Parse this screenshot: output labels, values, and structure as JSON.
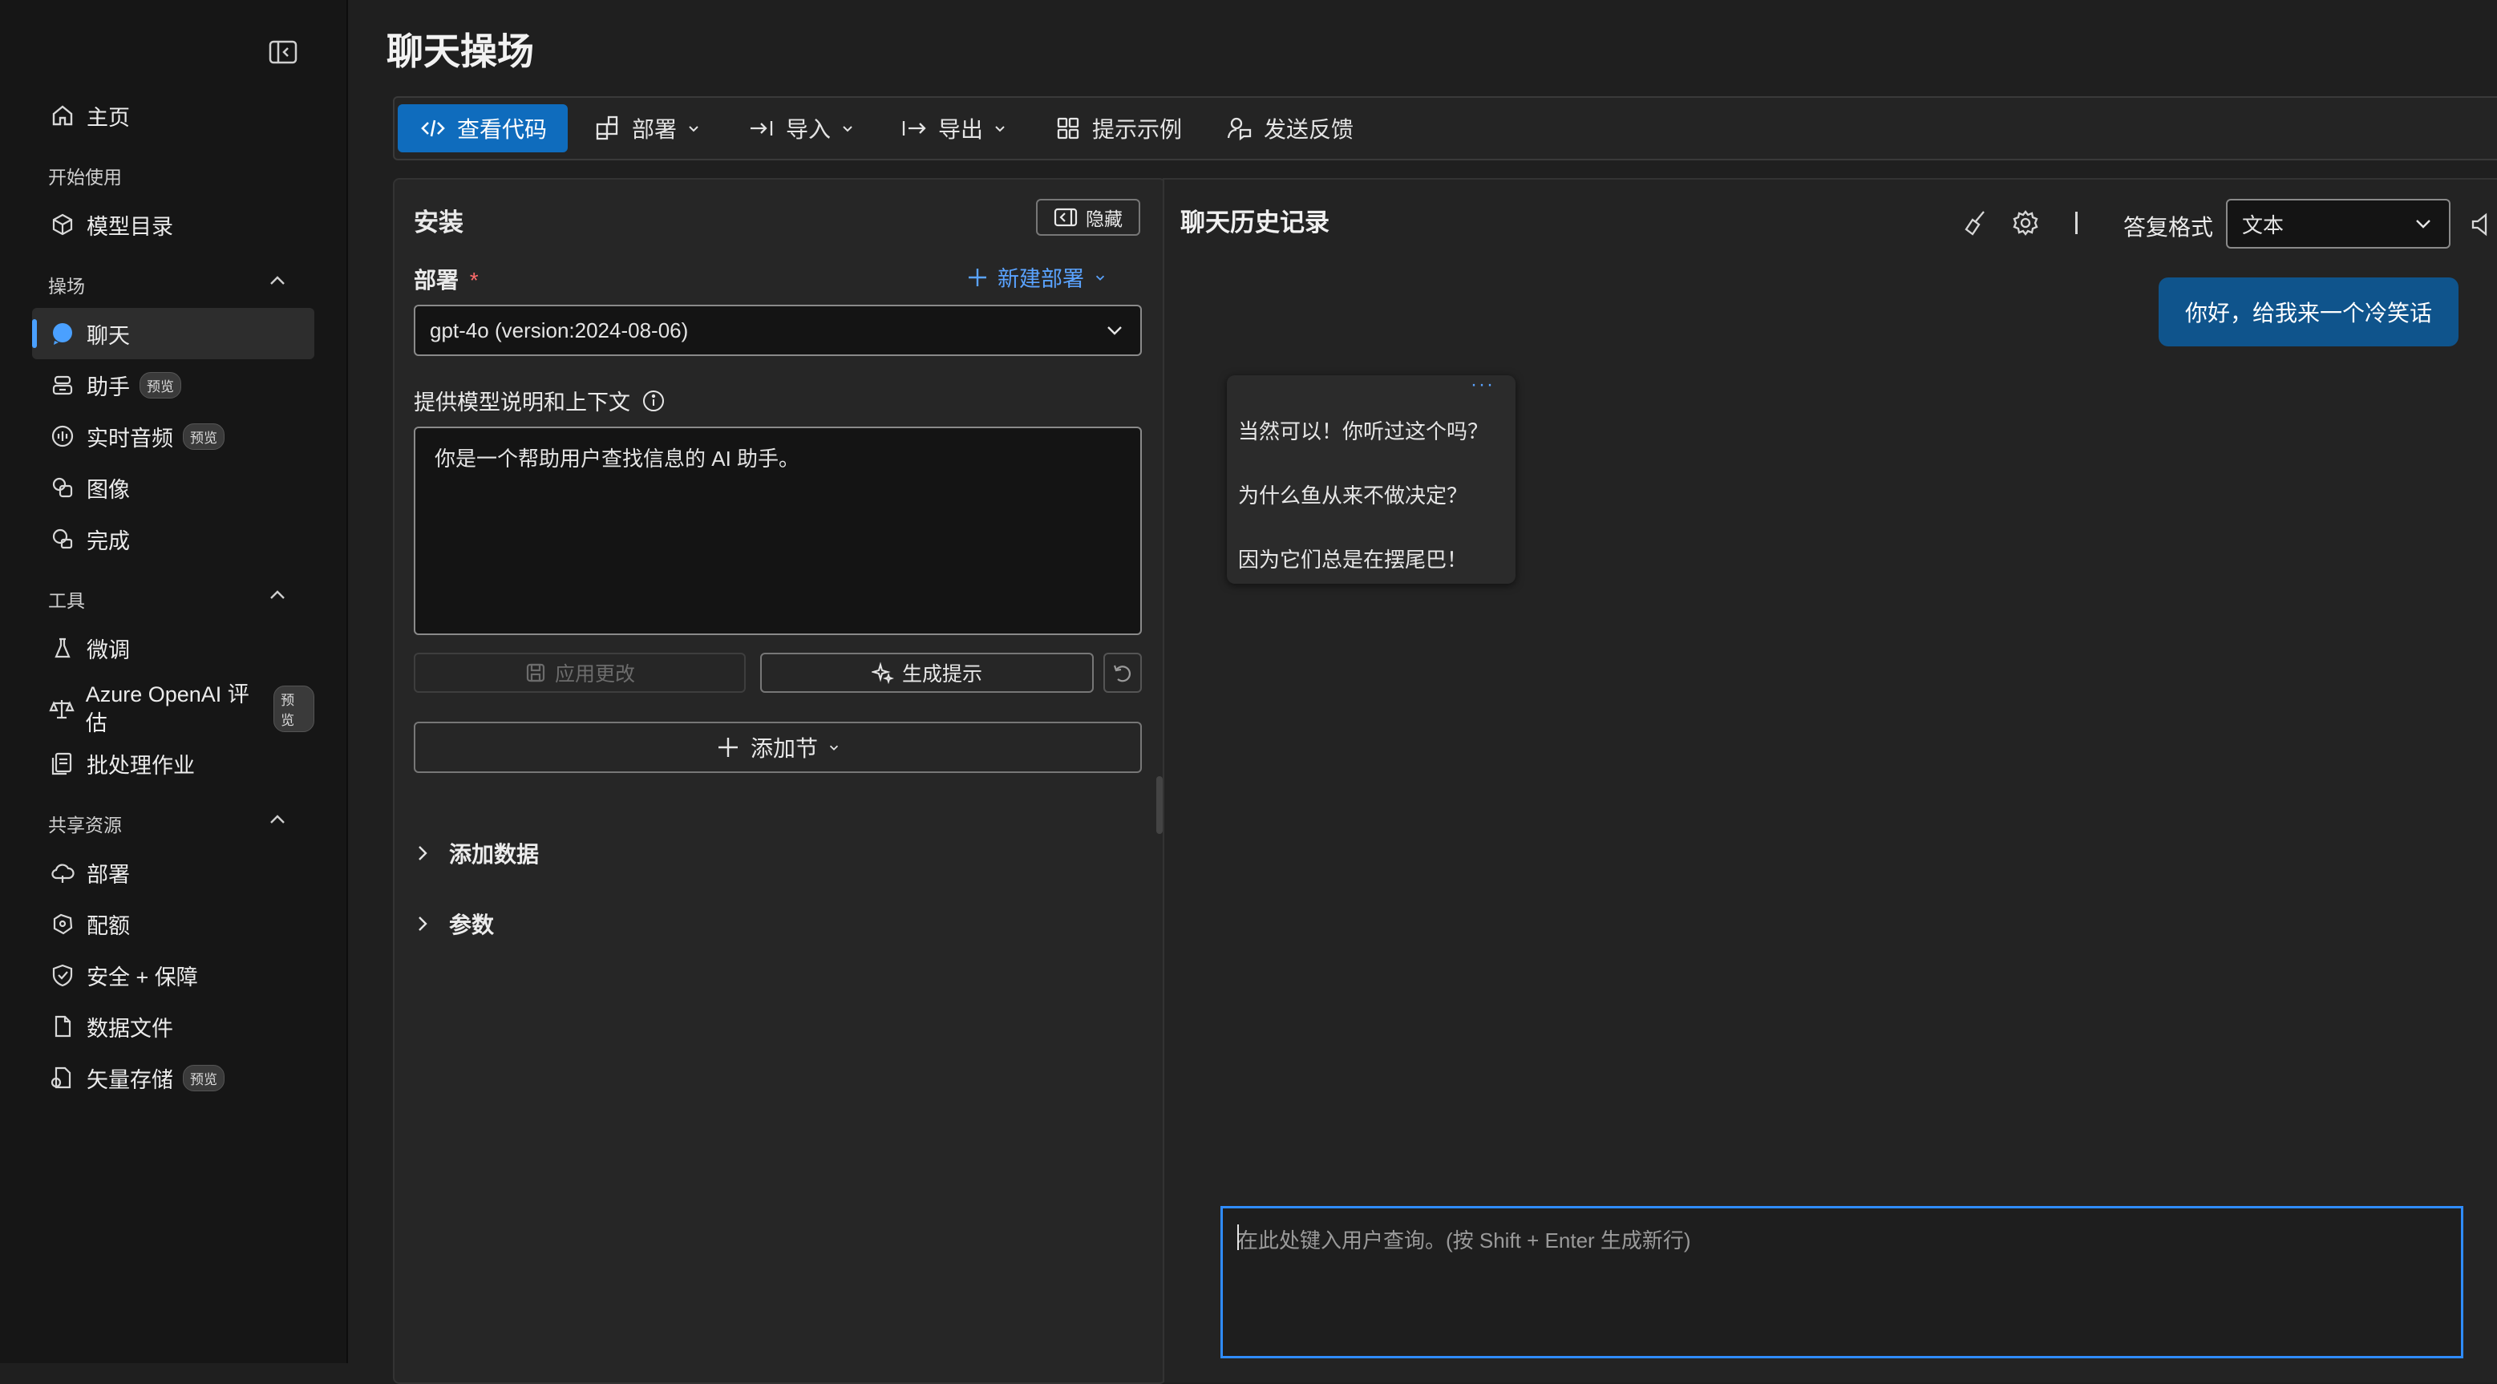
{
  "sidebar": {
    "home": "主页",
    "section_getting_started": "开始使用",
    "model_catalog": "模型目录",
    "section_playground": "操场",
    "chat": "聊天",
    "assistants": "助手",
    "realtime_audio": "实时音频",
    "images": "图像",
    "completions": "完成",
    "section_tools": "工具",
    "fine_tuning": "微调",
    "azure_eval": "Azure OpenAI 评估",
    "batch_jobs": "批处理作业",
    "section_shared": "共享资源",
    "deployments": "部署",
    "quota": "配额",
    "safety": "安全 + 保障",
    "data_files": "数据文件",
    "vector_stores": "矢量存储",
    "preview_badge": "预览"
  },
  "page": {
    "title": "聊天操场"
  },
  "toolbar": {
    "view_code": "查看代码",
    "deploy": "部署",
    "import": "导入",
    "export": "导出",
    "prompt_samples": "提示示例",
    "feedback": "发送反馈"
  },
  "setup": {
    "title": "安装",
    "hide": "隐藏",
    "deployment_label": "部署",
    "required_mark": "*",
    "new_deployment": "新建部署",
    "deployment_value": "gpt-4o (version:2024-08-06)",
    "system_message_label": "提供模型说明和上下文",
    "system_message_value": "你是一个帮助用户查找信息的 AI 助手。",
    "apply_changes": "应用更改",
    "generate_prompt": "生成提示",
    "add_section": "添加节",
    "add_data": "添加数据",
    "parameters": "参数"
  },
  "chat": {
    "title": "聊天历史记录",
    "response_format_label": "答复格式",
    "response_format_value": "文本",
    "user_message": "你好，给我来一个冷笑话",
    "bot_line1": "当然可以！你听过这个吗？",
    "bot_line2": "为什么鱼从来不做决定？",
    "bot_line3": "因为它们总是在摆尾巴！",
    "bot_more": "···",
    "input_placeholder": "在此处键入用户查询。(按 Shift + Enter 生成新行)"
  },
  "colors": {
    "accent": "#0f6cbd",
    "user_bubble": "#0f548c",
    "focus_border": "#2f8cff"
  }
}
